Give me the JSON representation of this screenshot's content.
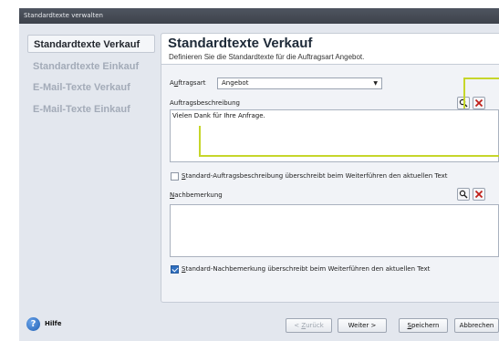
{
  "window": {
    "title": "Standardtexte verwalten"
  },
  "nav": {
    "items": [
      {
        "label": "Standardtexte Verkauf"
      },
      {
        "label": "Standardtexte Einkauf"
      },
      {
        "label": "E-Mail-Texte Verkauf"
      },
      {
        "label": "E-Mail-Texte Einkauf"
      }
    ]
  },
  "main": {
    "title": "Standardtexte Verkauf",
    "subtitle": "Definieren Sie die Standardtexte für die Auftragsart Angebot.",
    "auftragsart": {
      "label_first": "A",
      "label_underlined": "u",
      "label_rest": "ftragsart",
      "value": "Angebot"
    },
    "auftragsbeschreibung": {
      "label": "Auftragsbeschreibung",
      "text": "Vielen Dank für Ihre Anfrage."
    },
    "checkbox1": {
      "underlined": "S",
      "label_rest": "tandard-Auftragsbeschreibung überschreibt beim Weiterführen den aktuellen Text",
      "checked": false
    },
    "nachbemerkung": {
      "label_underlined": "N",
      "label_rest": "achbemerkung",
      "text": ""
    },
    "checkbox2": {
      "underlined": "S",
      "label_rest": "tandard-Nachbemerkung überschreibt beim Weiterführen den aktuellen Text",
      "checked": true
    }
  },
  "footer": {
    "help_label": "Hilfe",
    "back_prefix": "< ",
    "back_underlined": "Z",
    "back_rest": "urück",
    "next_label": "Weiter >",
    "save_underlined": "S",
    "save_rest": "peichern",
    "cancel_label": "Abbrechen"
  },
  "colors": {
    "accent": "#2f6fc0",
    "callout": "#c6d62a",
    "titlebar": "#444a53"
  }
}
